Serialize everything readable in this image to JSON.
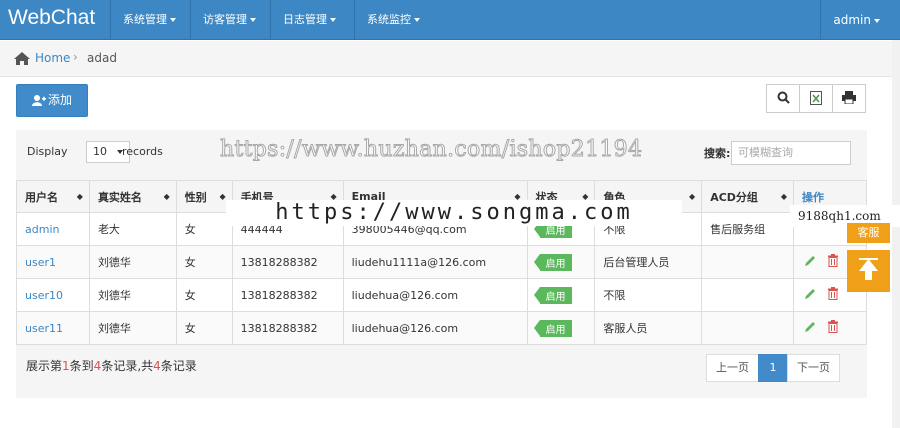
{
  "nav": {
    "brand": "WebChat",
    "menus": [
      "系统管理",
      "访客管理",
      "日志管理",
      "系统监控"
    ],
    "user": "admin"
  },
  "breadcrumb": {
    "home": "Home",
    "separator": "›",
    "current": "adad"
  },
  "toolbar": {
    "add_label": "添加",
    "icons": [
      "search-icon",
      "excel-icon",
      "print-icon"
    ]
  },
  "table_controls": {
    "display_label": "Display",
    "page_size": "10",
    "records_label": "records",
    "search_label": "搜索:",
    "search_placeholder": "可模糊查询"
  },
  "table": {
    "columns": [
      "用户名",
      "真实姓名",
      "性别",
      "手机号",
      "Email",
      "状态",
      "角色",
      "ACD分组",
      "操作"
    ],
    "rows": [
      {
        "username": "admin",
        "realname": "老大",
        "gender": "女",
        "phone": "444444",
        "email": "398005446@qq.com",
        "status": "启用",
        "role": "不限",
        "acd": "售后服务组"
      },
      {
        "username": "user1",
        "realname": "刘德华",
        "gender": "女",
        "phone": "13818288382",
        "email": "liudehu1111a@126.com",
        "status": "启用",
        "role": "后台管理人员",
        "acd": ""
      },
      {
        "username": "user10",
        "realname": "刘德华",
        "gender": "女",
        "phone": "13818288382",
        "email": "liudehua@126.com",
        "status": "启用",
        "role": "不限",
        "acd": ""
      },
      {
        "username": "user11",
        "realname": "刘德华",
        "gender": "女",
        "phone": "13818288382",
        "email": "liudehua@126.com",
        "status": "启用",
        "role": "客服人员",
        "acd": ""
      }
    ]
  },
  "footer": {
    "info_prefix": "展示第",
    "start": "1",
    "info_mid1": "条到",
    "end": "4",
    "info_mid2": "条记录,共",
    "total": "4",
    "info_suffix": "条记录",
    "prev": "上一页",
    "page": "1",
    "next": "下一页"
  },
  "overlays": {
    "watermark_top": "https://www.huzhan.com/ishop21194",
    "watermark_mid": "https://www.songma.com",
    "watermark_side": "9188qh1.com",
    "side_button": "客服"
  },
  "colors": {
    "navbar": "#3c87c4",
    "primary": "#428bca",
    "success": "#5cb85c",
    "accent": "#f0a018"
  }
}
